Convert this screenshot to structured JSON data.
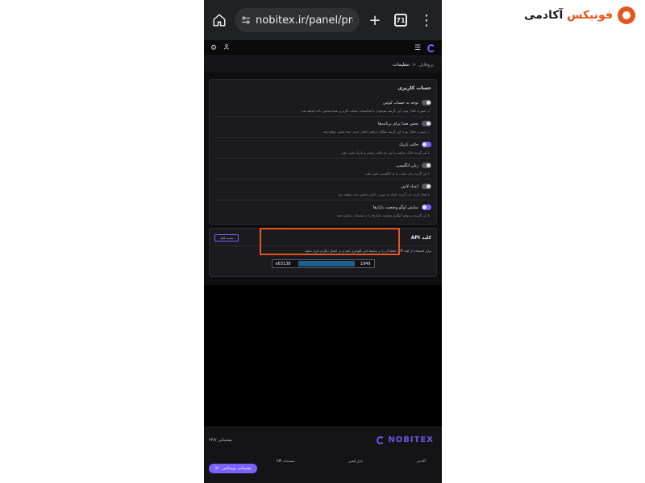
{
  "watermark": {
    "brand_accent": "فونیکس",
    "brand_rest": "آکادمی"
  },
  "browser": {
    "url": "nobitex.ir/panel/profile/",
    "tabs_count": "71"
  },
  "breadcrumb": {
    "parent": "پروفایل",
    "separator": "<",
    "current": "تنظیمات"
  },
  "account_settings": {
    "title": "حساب کاربری",
    "items": [
      {
        "label": "توجه به حساب کوئین",
        "desc": "در صورت فعال بودن این گزینه، موجودی با محاسبات حساب کاربری شما نمایش داده خواهد شد",
        "on": false
      },
      {
        "label": "پخش صدا برای برنامه‌ها",
        "desc": "در صورت فعال بودن این گزینه، هنگام دریافت اعلان جدید، صدا پخش خواهد شد",
        "on": false
      },
      {
        "label": "حالت تاریک",
        "desc": "با این گزینه حالت نمایش را بین دو حالت روشن و تاریک تغییر دهید",
        "on": true
      },
      {
        "label": "زبان انگلیسی",
        "desc": "با این گزینه زبان سایت را به انگلیسی تغییر دهید",
        "on": false
      },
      {
        "label": "اعداد لاتین",
        "desc": "با فعال کردن این گزینه، اعداد به صورت لاتین نمایش داده خواهند شد",
        "on": false
      },
      {
        "label": "نمایش لوگو وضعیت بازارها",
        "desc": "با این گزینه می‌توانید لوگوی وضعیت بازارها را در صفحات نمایش دهید",
        "on": true
      }
    ]
  },
  "api": {
    "title": "کلید API",
    "button_label": "تمدید کلید",
    "desc": "برای استفاده از کلید API، لطفا آن را در محیط امن نگهداری کنید و در اختیار دیگران قرار ندهید",
    "key_start": "e63138",
    "key_end": "1849"
  },
  "footer": {
    "logo": "NOBITEX",
    "support_phone": "پشتیبانی ۲۴/۷",
    "links": [
      "آکادمی",
      "بازار آپشن",
      "مستندات API"
    ],
    "support_button": "پشتیبانی نوبیتکس"
  },
  "colors": {
    "accent": "#7b61ff",
    "highlight": "#e8541e",
    "key_mask": "#1f5f8b"
  }
}
